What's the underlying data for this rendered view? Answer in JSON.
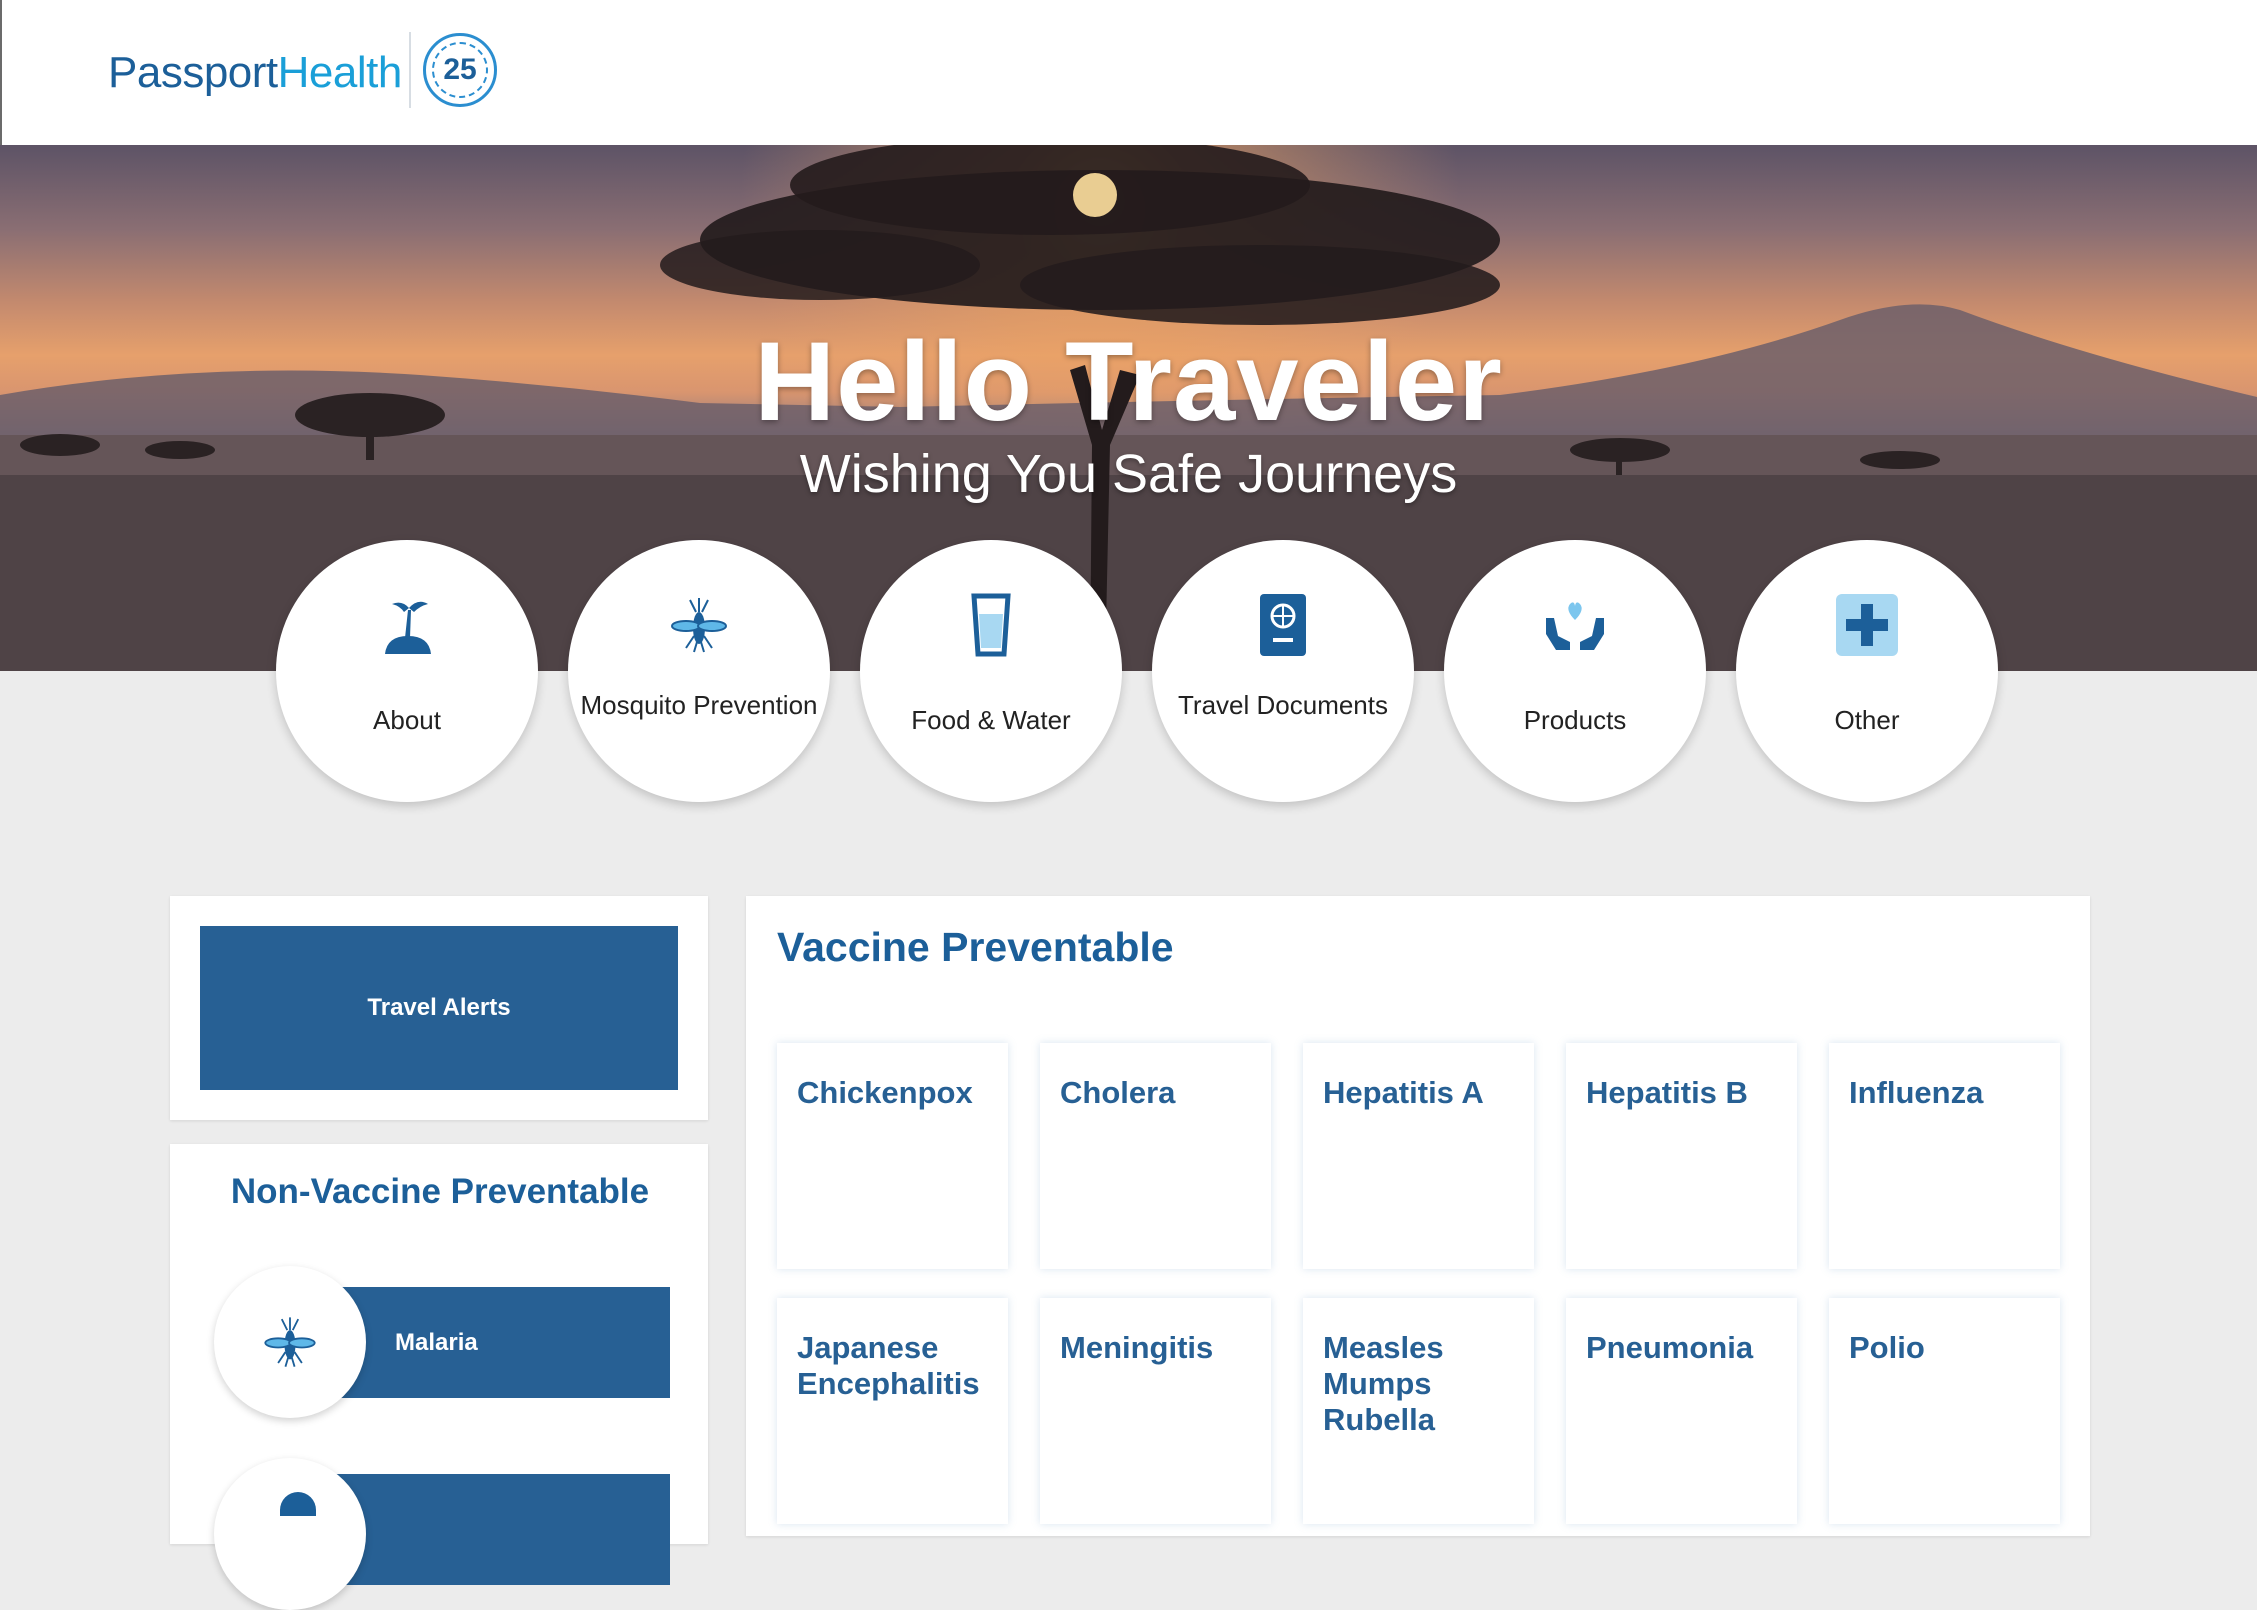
{
  "header": {
    "logo_part1": "Passport",
    "logo_part2": "Health",
    "badge_number": "25"
  },
  "hero": {
    "title": "Hello Traveler",
    "subtitle": "Wishing You Safe Journeys"
  },
  "nav_circles": [
    {
      "label": "About",
      "icon": "island-icon"
    },
    {
      "label": "Mosquito Prevention",
      "icon": "mosquito-icon"
    },
    {
      "label": "Food & Water",
      "icon": "water-glass-icon"
    },
    {
      "label": "Travel Documents",
      "icon": "passport-icon"
    },
    {
      "label": "Products",
      "icon": "hands-heart-icon"
    },
    {
      "label": "Other",
      "icon": "plus-icon"
    }
  ],
  "sidebar": {
    "travel_alerts_label": "Travel Alerts",
    "non_vaccine_title": "Non-Vaccine Preventable",
    "non_vaccine_items": [
      {
        "label": "Malaria",
        "icon": "mosquito-icon"
      }
    ]
  },
  "vaccine_preventable": {
    "title": "Vaccine Preventable",
    "items": [
      "Chickenpox",
      "Cholera",
      "Hepatitis A",
      "Hepatitis B",
      "Influenza",
      "Japanese Encephalitis",
      "Meningitis",
      "Measles Mumps Rubella",
      "Pneumonia",
      "Polio"
    ]
  },
  "colors": {
    "brand_blue": "#1c5f99",
    "button_blue": "#276094",
    "background": "#ececec"
  }
}
